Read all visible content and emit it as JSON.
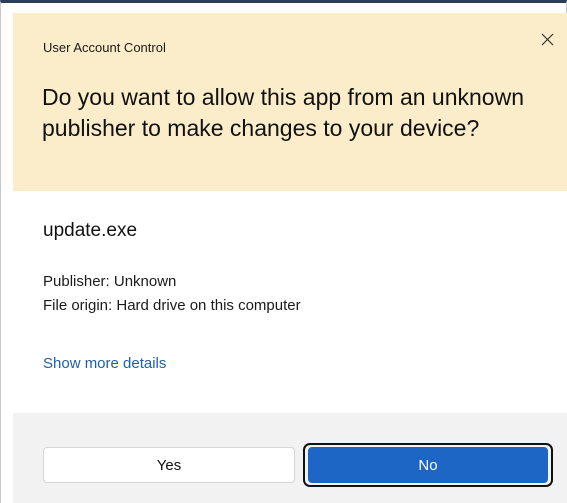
{
  "window": {
    "title": "User Account Control",
    "close_icon": "close-icon"
  },
  "header": {
    "question": "Do you want to allow this app from an unknown publisher to make changes to your device?",
    "background_color": "#fcedca"
  },
  "details": {
    "app_name": "update.exe",
    "publisher": "Publisher: Unknown",
    "file_origin": "File origin: Hard drive on this computer",
    "show_more_label": "Show more details",
    "link_color": "#1f5fa8"
  },
  "buttons": {
    "yes_label": "Yes",
    "no_label": "No",
    "primary_color": "#1e66c6"
  }
}
